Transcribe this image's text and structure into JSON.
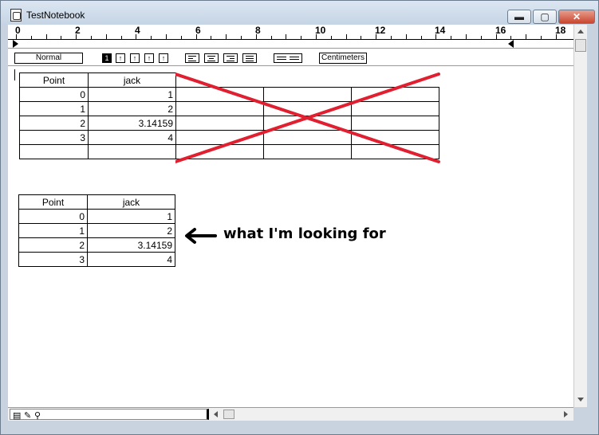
{
  "window": {
    "title": "TestNotebook",
    "min_label": "▬",
    "max_label": "▢",
    "close_label": "✕"
  },
  "ruler": {
    "numbers": [
      "0",
      "2",
      "4",
      "6",
      "8",
      "10",
      "12",
      "14",
      "16",
      "18"
    ]
  },
  "toolbar": {
    "style_value": "Normal",
    "units_value": "Centimeters",
    "spacing_buttons": [
      "1",
      "↑",
      "↑",
      "↑",
      "↑"
    ]
  },
  "table_top": {
    "headers": [
      "Point",
      "jack"
    ],
    "rows": [
      [
        "0",
        "1"
      ],
      [
        "1",
        "2"
      ],
      [
        "2",
        "3.14159"
      ],
      [
        "3",
        "4"
      ],
      [
        "",
        ""
      ]
    ]
  },
  "table_bottom": {
    "headers": [
      "Point",
      "jack"
    ],
    "rows": [
      [
        "0",
        "1"
      ],
      [
        "1",
        "2"
      ],
      [
        "2",
        "3.14159"
      ],
      [
        "3",
        "4"
      ]
    ]
  },
  "annotation": {
    "text": "what I'm looking for",
    "cross_color": "#e02020"
  }
}
